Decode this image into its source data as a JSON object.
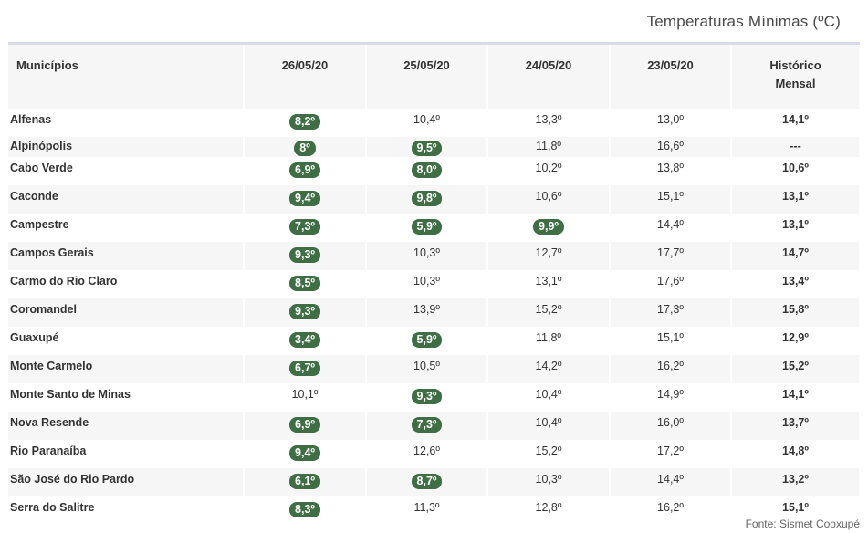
{
  "title": "Temperaturas Mínimas (ºC)",
  "source": "Fonte: Sismet Cooxupé",
  "headers": {
    "municipio": "Municípios",
    "d1": "26/05/20",
    "d2": "25/05/20",
    "d3": "24/05/20",
    "d4": "23/05/20",
    "hist_line1": "Histórico",
    "hist_line2": "Mensal"
  },
  "highlight_color": "#3f6e45",
  "rows": [
    {
      "name": "Alfenas",
      "d1": "8,2º",
      "d2": "10,4º",
      "d3": "13,3º",
      "d4": "13,0º",
      "hist": "14,1º",
      "h1": true,
      "h2": false,
      "h3": false
    },
    {
      "name": "Alpinópolis",
      "d1": "8º",
      "d2": "9,5º",
      "d3": "11,8º",
      "d4": "16,6º",
      "hist": "---",
      "h1": true,
      "h2": true,
      "h3": false
    },
    {
      "name": "Cabo Verde",
      "d1": "6,9º",
      "d2": "8,0º",
      "d3": "10,2º",
      "d4": "13,8º",
      "hist": "10,6º",
      "h1": true,
      "h2": true,
      "h3": false
    },
    {
      "name": "Caconde",
      "d1": "9,4º",
      "d2": "9,8º",
      "d3": "10,6º",
      "d4": "15,1º",
      "hist": "13,1º",
      "h1": true,
      "h2": true,
      "h3": false
    },
    {
      "name": "Campestre",
      "d1": "7,3º",
      "d2": "5,9º",
      "d3": "9,9º",
      "d4": "14,4º",
      "hist": "13,1º",
      "h1": true,
      "h2": true,
      "h3": true
    },
    {
      "name": "Campos Gerais",
      "d1": "9,3º",
      "d2": "10,3º",
      "d3": "12,7º",
      "d4": "17,7º",
      "hist": "14,7º",
      "h1": true,
      "h2": false,
      "h3": false
    },
    {
      "name": "Carmo do Rio Claro",
      "d1": "8,5º",
      "d2": "10,3º",
      "d3": "13,1º",
      "d4": "17,6º",
      "hist": "13,4º",
      "h1": true,
      "h2": false,
      "h3": false
    },
    {
      "name": "Coromandel",
      "d1": "9,3º",
      "d2": "13,9º",
      "d3": "15,2º",
      "d4": "17,3º",
      "hist": "15,8º",
      "h1": true,
      "h2": false,
      "h3": false
    },
    {
      "name": "Guaxupé",
      "d1": "3,4º",
      "d2": "5,9º",
      "d3": "11,8º",
      "d4": "15,1º",
      "hist": "12,9º",
      "h1": true,
      "h2": true,
      "h3": false
    },
    {
      "name": "Monte Carmelo",
      "d1": "6,7º",
      "d2": "10,5º",
      "d3": "14,2º",
      "d4": "16,2º",
      "hist": "15,2º",
      "h1": true,
      "h2": false,
      "h3": false
    },
    {
      "name": "Monte Santo de Minas",
      "d1": "10,1º",
      "d2": "9,3º",
      "d3": "10,4º",
      "d4": "14,9º",
      "hist": "14,1º",
      "h1": false,
      "h2": true,
      "h3": false
    },
    {
      "name": "Nova Resende",
      "d1": "6,9º",
      "d2": "7,3º",
      "d3": "10,4º",
      "d4": "16,0º",
      "hist": "13,7º",
      "h1": true,
      "h2": true,
      "h3": false
    },
    {
      "name": "Rio Paranaíba",
      "d1": "9,4º",
      "d2": "12,6º",
      "d3": "15,2º",
      "d4": "17,2º",
      "hist": "14,8º",
      "h1": true,
      "h2": false,
      "h3": false
    },
    {
      "name": "São José do Rio Pardo",
      "d1": "6,1º",
      "d2": "8,7º",
      "d3": "10,3º",
      "d4": "14,4º",
      "hist": "13,2º",
      "h1": true,
      "h2": true,
      "h3": false
    },
    {
      "name": "Serra do Salitre",
      "d1": "8,3º",
      "d2": "11,3º",
      "d3": "12,8º",
      "d4": "16,2º",
      "hist": "15,1º",
      "h1": true,
      "h2": false,
      "h3": false
    }
  ]
}
